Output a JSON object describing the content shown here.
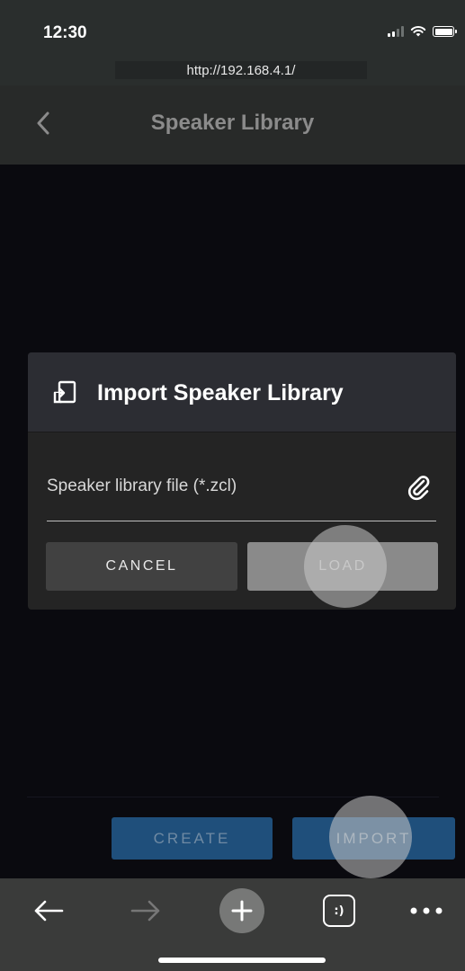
{
  "status_bar": {
    "time": "12:30"
  },
  "browser": {
    "url": "http://192.168.4.1/"
  },
  "header": {
    "title": "Speaker Library"
  },
  "dialog": {
    "title": "Import Speaker Library",
    "file_field_label": "Speaker library file (*.zcl)",
    "cancel_label": "CANCEL",
    "load_label": "LOAD"
  },
  "actions": {
    "create_label": "CREATE",
    "import_label": "IMPORT"
  },
  "toolbar": {
    "tabs_label": ":)"
  },
  "icons": {
    "back": "chevron-left-icon",
    "dialog": "import-file-icon",
    "attach": "paperclip-icon",
    "browser_back": "arrow-left-icon",
    "browser_forward": "arrow-right-icon",
    "add_tab": "plus-icon",
    "more": "ellipsis-icon"
  },
  "colors": {
    "accent_button": "#1f4f7b",
    "dialog_bg": "#242424",
    "dialog_header_bg": "#2c2d33"
  }
}
